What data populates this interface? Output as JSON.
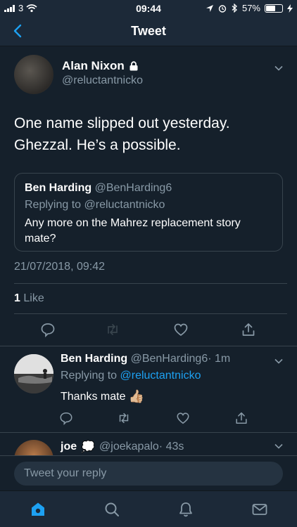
{
  "status_bar": {
    "carrier": "3",
    "time": "09:44",
    "battery": "57%",
    "battery_level": 0.57
  },
  "navbar": {
    "title": "Tweet"
  },
  "main_tweet": {
    "author_name": "Alan Nixon",
    "author_handle": "@reluctantnicko",
    "text_line1": "One name slipped out yesterday.",
    "text_line2": "Ghezzal. He’s a possible.",
    "timestamp": "21/07/2018, 09:42",
    "like_count": "1",
    "like_label": "Like"
  },
  "quoted_tweet": {
    "author_name": "Ben Harding",
    "author_handle": "@BenHarding6",
    "replying_to": "Replying to @reluctantnicko",
    "text": "Any more on the Mahrez replacement story mate?"
  },
  "replies": [
    {
      "author_name": "Ben Harding",
      "author_handle": "@BenHarding6",
      "time": "· 1m",
      "replying_to_label": "Replying to",
      "replying_to_handle": "@reluctantnicko",
      "text": "Thanks mate",
      "emoji": "👍🏼"
    },
    {
      "author_name": "joe",
      "emoji": "💭",
      "author_handle": "@joekapalo",
      "time": "· 43s"
    }
  ],
  "reply_bar": {
    "placeholder": "Tweet your reply"
  },
  "tabs": [
    "home-icon",
    "search-icon",
    "notifications-icon",
    "messages-icon"
  ],
  "colors": {
    "background": "#15202b",
    "bar_background": "#1c2938",
    "accent": "#1da1f2",
    "muted": "#8899a6",
    "divider": "#38444d"
  }
}
